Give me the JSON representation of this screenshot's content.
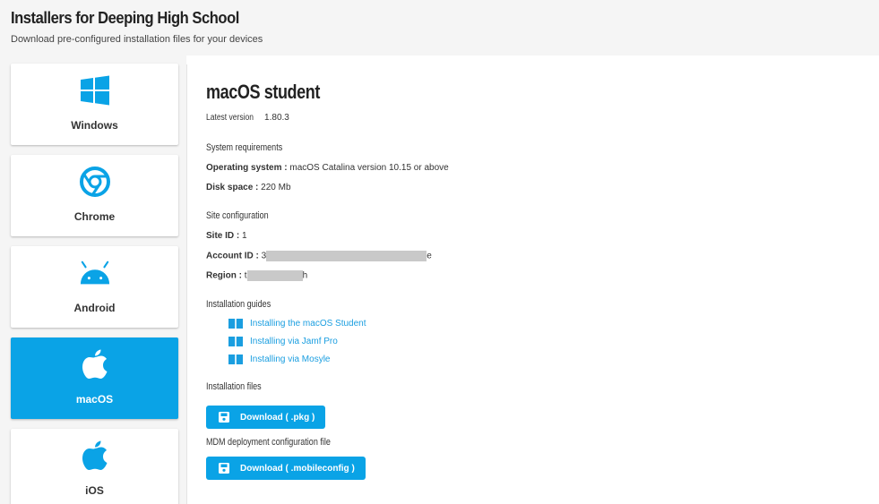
{
  "header": {
    "title": "Installers for Deeping High School",
    "subtitle": "Download pre-configured installation files for your devices"
  },
  "sidebar": {
    "items": [
      {
        "label": "Windows",
        "icon": "windows-icon",
        "active": false
      },
      {
        "label": "Chrome",
        "icon": "chrome-icon",
        "active": false
      },
      {
        "label": "Android",
        "icon": "android-icon",
        "active": false
      },
      {
        "label": "macOS",
        "icon": "apple-icon",
        "active": true
      },
      {
        "label": "iOS",
        "icon": "apple-icon",
        "active": false
      }
    ]
  },
  "main": {
    "title": "macOS student",
    "latest_version_label": "Latest version",
    "latest_version": "1.80.3",
    "system_requirements": {
      "heading": "System requirements",
      "os_label": "Operating system :",
      "os_value": "macOS Catalina version 10.15 or above",
      "disk_label": "Disk space :",
      "disk_value": "220 Mb"
    },
    "site_configuration": {
      "heading": "Site configuration",
      "site_id_label": "Site ID :",
      "site_id_value": "1",
      "account_id_label": "Account ID :",
      "account_id_prefix": "3",
      "account_id_suffix": "e",
      "region_label": "Region :",
      "region_prefix": "t",
      "region_suffix": "h"
    },
    "installation_guides": {
      "heading": "Installation guides",
      "links": [
        "Installing the macOS Student",
        "Installing via Jamf Pro",
        "Installing via Mosyle"
      ]
    },
    "installation_files": {
      "heading": "Installation files",
      "button": "Download ( .pkg )"
    },
    "mdm": {
      "heading": "MDM deployment configuration file",
      "button": "Download ( .mobileconfig )"
    }
  },
  "colors": {
    "accent": "#0aa3e6",
    "link": "#1a9ee0",
    "background": "#f5f5f5"
  }
}
